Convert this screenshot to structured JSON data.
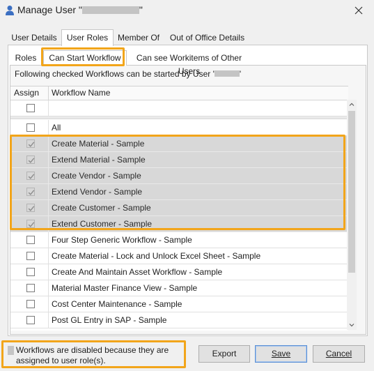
{
  "window": {
    "title_prefix": "Manage User \"",
    "title_suffix": "\"",
    "close_label": "✕"
  },
  "tabs": [
    {
      "label": "User Details"
    },
    {
      "label": "User Roles"
    },
    {
      "label": "Member Of"
    },
    {
      "label": "Out of Office Details"
    }
  ],
  "subtabs": [
    {
      "label": "Roles"
    },
    {
      "label": "Can Start Workflow"
    },
    {
      "label": "Can see Workitems of Other Users"
    }
  ],
  "info": {
    "prefix": "Following checked Workflows can be started by User '",
    "suffix": "'"
  },
  "grid": {
    "columns": {
      "assign": "Assign",
      "name": "Workflow Name"
    },
    "filter_row": {
      "name": ""
    },
    "rows": [
      {
        "name": "All",
        "checked": false,
        "disabled": false
      },
      {
        "name": "Create Material - Sample",
        "checked": true,
        "disabled": true
      },
      {
        "name": "Extend Material - Sample",
        "checked": true,
        "disabled": true
      },
      {
        "name": "Create Vendor - Sample",
        "checked": true,
        "disabled": true
      },
      {
        "name": "Extend Vendor - Sample",
        "checked": true,
        "disabled": true
      },
      {
        "name": "Create Customer - Sample",
        "checked": true,
        "disabled": true
      },
      {
        "name": "Extend Customer - Sample",
        "checked": true,
        "disabled": true
      },
      {
        "name": "Four Step Generic Workflow - Sample",
        "checked": false,
        "disabled": false
      },
      {
        "name": "Create Material - Lock and Unlock Excel Sheet - Sample",
        "checked": false,
        "disabled": false
      },
      {
        "name": "Create And Maintain Asset Workflow - Sample",
        "checked": false,
        "disabled": false
      },
      {
        "name": "Material Master Finance View - Sample",
        "checked": false,
        "disabled": false
      },
      {
        "name": "Cost Center Maintenance - Sample",
        "checked": false,
        "disabled": false
      },
      {
        "name": "Post GL Entry in SAP - Sample",
        "checked": false,
        "disabled": false
      }
    ]
  },
  "legend": {
    "text": "Workflows are disabled because they are assigned to user role(s)."
  },
  "buttons": {
    "export": "Export",
    "save": "Save",
    "cancel": "Cancel"
  },
  "colors": {
    "highlight": "#f2a51a",
    "disabled_row": "#d8d8d8",
    "default_button_border": "#5b8fd4"
  },
  "icons": {
    "title": "user-icon",
    "close": "close-icon",
    "checkbox": "checkmark-icon"
  }
}
